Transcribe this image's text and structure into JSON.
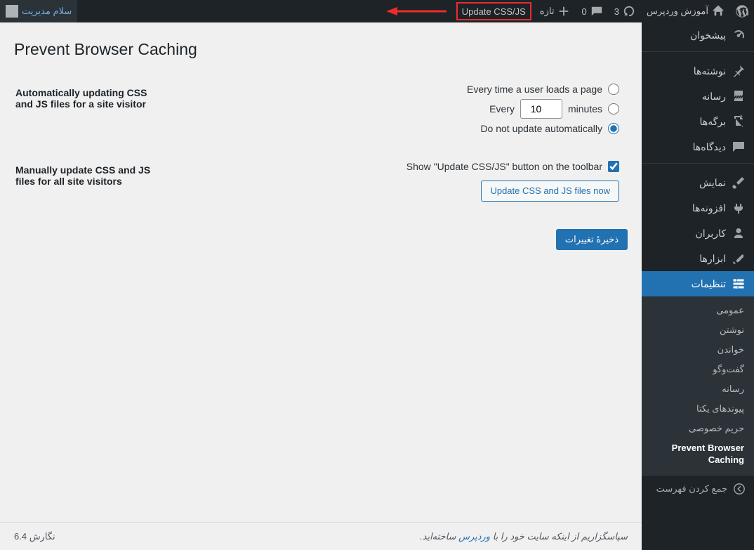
{
  "adminbar": {
    "site_title": "آموزش وردپرس",
    "update_count": "3",
    "comment_count": "0",
    "new_label": "تازه",
    "update_btn": "Update CSS/JS",
    "greeting": "سلام مدیریت"
  },
  "sidebar": {
    "dashboard": "پیشخوان",
    "posts": "نوشته‌ها",
    "media": "رسانه",
    "pages": "برگه‌ها",
    "comments": "دیدگاه‌ها",
    "appearance": "نمایش",
    "plugins": "افزونه‌ها",
    "users": "کاربران",
    "tools": "ابزارها",
    "settings": "تنظیمات",
    "submenu": {
      "general": "عمومی",
      "writing": "نوشتن",
      "reading": "خواندن",
      "discussion": "گفت‌وگو",
      "media": "رسانه",
      "permalinks": "پیوندهای یکتا",
      "privacy": "حریم خصوصی",
      "pbc": "Prevent Browser Caching"
    },
    "collapse": "جمع کردن فهرست"
  },
  "page": {
    "title": "Prevent Browser Caching",
    "auto_heading": "Automatically updating CSS and JS files for a site visitor",
    "opt_every_load": "Every time a user loads a page",
    "opt_every_prefix": "Every",
    "opt_every_value": "10",
    "opt_every_suffix": "minutes",
    "opt_no_update": "Do not update automatically",
    "manual_heading": "Manually update CSS and JS files for all site visitors",
    "show_toolbar_label": "Show \"Update CSS/JS\" button on the toolbar",
    "update_now_btn": "Update CSS and JS files now",
    "save_btn": "ذخیرهٔ تغییرات"
  },
  "footer": {
    "thanks_prefix": "سپاسگزاریم از اینکه سایت خود را با ",
    "wp": "وردپرس",
    "thanks_suffix": " ساخته‌اید.",
    "version": "نگارش 6.4"
  }
}
